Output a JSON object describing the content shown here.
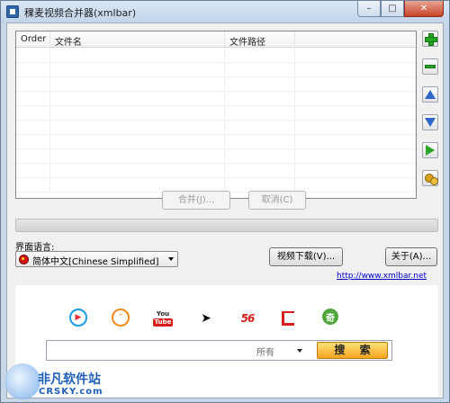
{
  "window": {
    "title": "稞麦视频合并器(xmlbar)",
    "minimize_glyph": "–",
    "maximize_glyph": "□",
    "close_glyph": "✕"
  },
  "list": {
    "columns": [
      "Order",
      "文件名",
      "文件路径",
      ""
    ],
    "rows": []
  },
  "side_buttons": {
    "add_icon": "add-icon",
    "remove_icon": "remove-icon",
    "up_icon": "arrow-up-icon",
    "down_icon": "arrow-down-icon",
    "play_icon": "play-icon",
    "settings_icon": "gears-icon"
  },
  "actions": {
    "merge_label": "合并(J)...",
    "cancel_label": "取消(C)"
  },
  "progress": {
    "value": 0
  },
  "language": {
    "label": "界面语言:",
    "selected": "简体中文[Chinese Simplified]"
  },
  "buttons": {
    "video_download_label": "视频下载(V)...",
    "about_label": "关于(A)..."
  },
  "homepage_link": "http://www.xmlbar.net",
  "video_sites": {
    "youtube_top": "You",
    "youtube_bottom": "Tube",
    "v56": "56"
  },
  "search": {
    "value": "",
    "scope": "所有",
    "button_label": "搜 索"
  },
  "watermark": {
    "main": "非凡软件站",
    "sub": "CRSKY.com"
  },
  "colors": {
    "progress_fill": "#06b025",
    "link": "#0000cc",
    "search_button": "#f4a420"
  }
}
